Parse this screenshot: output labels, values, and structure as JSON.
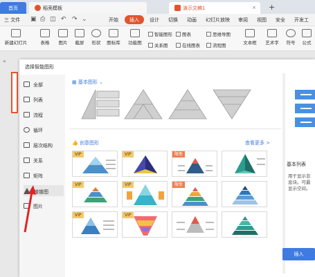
{
  "titlebar": {
    "home_tab": "首页",
    "template_tab": "稻壳模板",
    "doc_tab": "演示文稿1",
    "new_tab_symbol": "+",
    "close_symbol": "×"
  },
  "menubar": {
    "file_label": "三 文件",
    "items": [
      "开始",
      "插入",
      "设计",
      "切换",
      "动画",
      "幻灯片放映",
      "审阅",
      "视图",
      "安全",
      "开发工"
    ],
    "active": "插入"
  },
  "ribbon": {
    "new_slide": "新建幻灯片",
    "table": "表格",
    "picture": "图片",
    "screenshot": "截屏",
    "shape": "形状",
    "icon_lib": "图标库",
    "function_chart": "功能图",
    "smart_art": "智能图形",
    "chart": "图表",
    "relation_chart": "关系图",
    "online_chart": "在线图表",
    "mind_map": "思维导图",
    "flow_chart": "流程图",
    "text_box": "文本框",
    "art_text": "艺术字",
    "symbol": "符号",
    "formula": "公式"
  },
  "dialog": {
    "title": "选择智能图形",
    "sidebar": [
      {
        "label": "全部",
        "icon": "grid-icon"
      },
      {
        "label": "列表",
        "icon": "list-icon"
      },
      {
        "label": "流程",
        "icon": "flow-icon"
      },
      {
        "label": "循环",
        "icon": "cycle-icon"
      },
      {
        "label": "层次结构",
        "icon": "hierarchy-icon"
      },
      {
        "label": "关系",
        "icon": "relation-icon"
      },
      {
        "label": "矩阵",
        "icon": "matrix-icon"
      },
      {
        "label": "棱锥图",
        "icon": "pyramid-icon"
      },
      {
        "label": "图片",
        "icon": "picture-icon"
      }
    ],
    "active_category": "棱锥图",
    "basic_section": "基本图形",
    "creative_section": "创意图形",
    "see_more": "查看更多 >",
    "badges": {
      "vip": "VIP",
      "free": "限免"
    },
    "preview_title": "基本列表",
    "preview_desc": [
      "用于显示非",
      "息块。可最",
      "显示空间。"
    ],
    "insert_button": "插入"
  },
  "colors": {
    "accent": "#3f7be0",
    "brand": "#e2542e",
    "vip": "#f3c86a",
    "free": "#ef7c4a"
  }
}
